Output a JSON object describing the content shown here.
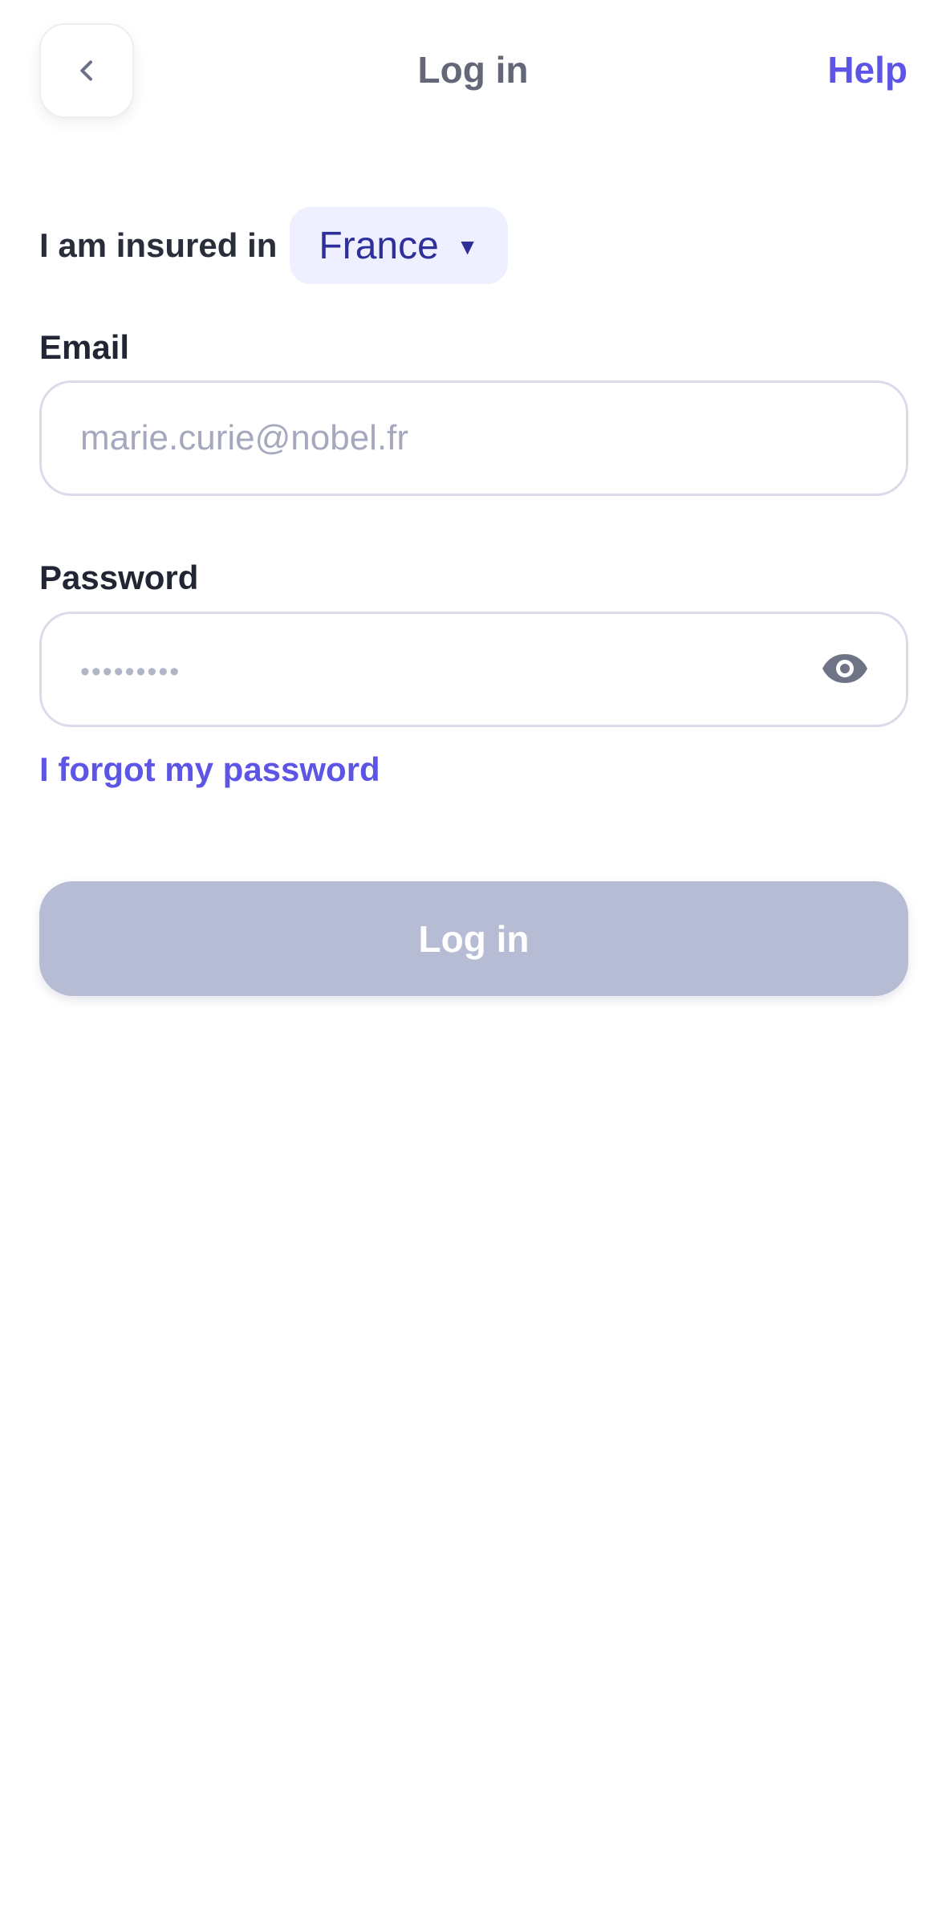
{
  "header": {
    "title": "Log in",
    "help": "Help",
    "back_icon": "chevron-left-icon"
  },
  "country": {
    "label": "I am insured in",
    "selected": "France",
    "dropdown_icon": "caret-down-icon"
  },
  "email": {
    "label": "Email",
    "placeholder": "marie.curie@nobel.fr",
    "value": ""
  },
  "password": {
    "label": "Password",
    "placeholder": "•••••••••",
    "value": "",
    "visibility_icon": "eye-icon"
  },
  "links": {
    "forgot_password": "I forgot my password"
  },
  "actions": {
    "login": "Log in"
  },
  "colors": {
    "accent": "#5C55E6",
    "button_disabled": "#B6BCD3",
    "country_select_bg": "#EEF0FF",
    "title": "#646778"
  }
}
